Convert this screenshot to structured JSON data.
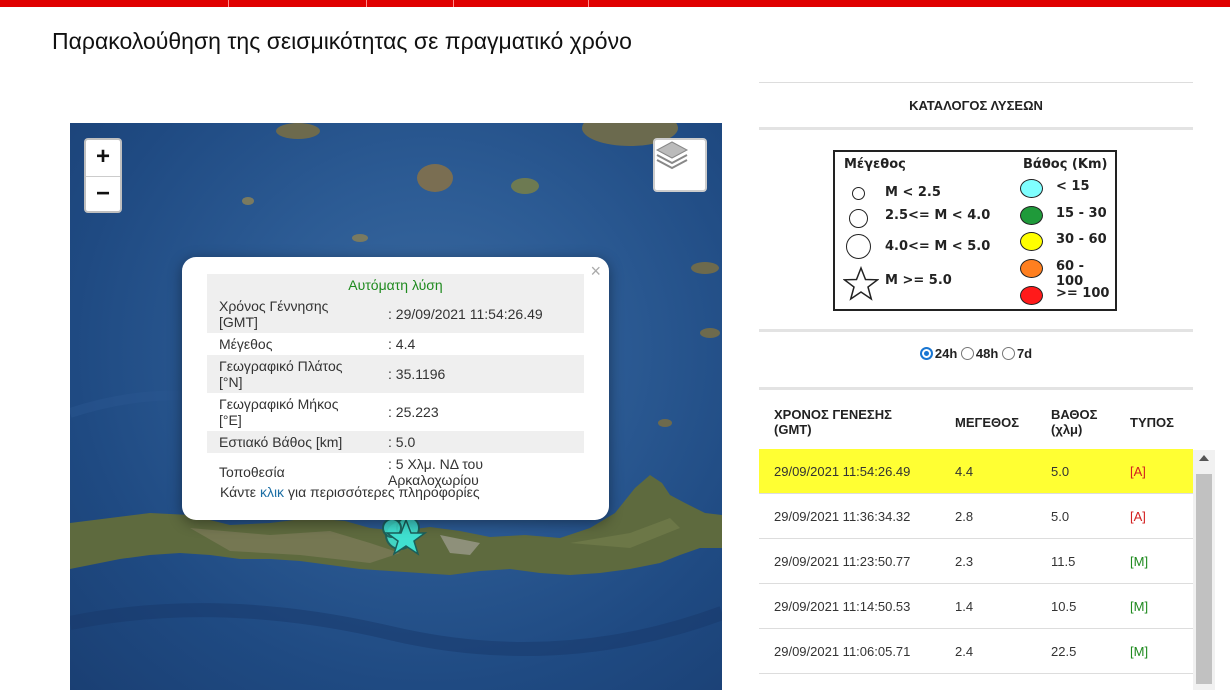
{
  "page": {
    "title": "Παρακολούθηση της σεισμικότητας σε πραγματικό χρόνο"
  },
  "map": {
    "zoom_in_label": "+",
    "zoom_out_label": "−",
    "layers_icon": "layers-icon",
    "popup": {
      "title": "Αυτόματη λύση",
      "close": "×",
      "rows": [
        {
          "key": "Χρόνος Γέννησης [GMT]",
          "value": ": 29/09/2021 11:54:26.49"
        },
        {
          "key": "Μέγεθος",
          "value": ": 4.4"
        },
        {
          "key": "Γεωγραφικό Πλάτος [°N]",
          "value": ": 35.1196"
        },
        {
          "key": "Γεωγραφικό Μήκος [°E]",
          "value": ": 25.223"
        },
        {
          "key": "Εστιακό Βάθος [km]",
          "value": ": 5.0"
        },
        {
          "key": "Τοποθεσία",
          "value": ": 5 Χλμ. ΝΔ του Αρκαλοχωρίου"
        }
      ],
      "more_prefix": "Κάντε",
      "more_link": "κλικ",
      "more_suffix": "για περισσότερες πληροφορίες"
    }
  },
  "catalog": {
    "title": "ΚΑΤΑΛΟΓΟΣ ΛΥΣΕΩΝ",
    "legend": {
      "size_header": "Μέγεθος",
      "depth_header": "Βάθος (Km)",
      "sizes": [
        "M < 2.5",
        "2.5<= M < 4.0",
        "4.0<= M < 5.0",
        "M >= 5.0"
      ],
      "depths": [
        {
          "label": "< 15",
          "color": "#7fffff"
        },
        {
          "label": "15 - 30",
          "color": "#1f9a3a"
        },
        {
          "label": "30 - 60",
          "color": "#ffff00"
        },
        {
          "label": "60 - 100",
          "color": "#ff7f1f"
        },
        {
          "label": ">= 100",
          "color": "#ff1a1a"
        }
      ]
    },
    "periods": {
      "p24": "24h",
      "p48": "48h",
      "p7": "7d",
      "selected": "24h"
    },
    "columns": {
      "time": "ΧΡΟΝΟΣ ΓΕΝΕΣΗΣ",
      "time_sub": "(GMT)",
      "mag": "ΜΕΓΕΘΟΣ",
      "depth": "ΒΑΘΟΣ",
      "depth_sub": "(χλμ)",
      "type": "ΤΥΠΟΣ"
    },
    "rows": [
      {
        "time": "29/09/2021 11:54:26.49",
        "mag": "4.4",
        "depth": "5.0",
        "type": "[A]"
      },
      {
        "time": "29/09/2021 11:36:34.32",
        "mag": "2.8",
        "depth": "5.0",
        "type": "[A]"
      },
      {
        "time": "29/09/2021 11:23:50.77",
        "mag": "2.3",
        "depth": "11.5",
        "type": "[M]"
      },
      {
        "time": "29/09/2021 11:14:50.53",
        "mag": "1.4",
        "depth": "10.5",
        "type": "[M]"
      },
      {
        "time": "29/09/2021 11:06:05.71",
        "mag": "2.4",
        "depth": "22.5",
        "type": "[M]"
      }
    ]
  }
}
